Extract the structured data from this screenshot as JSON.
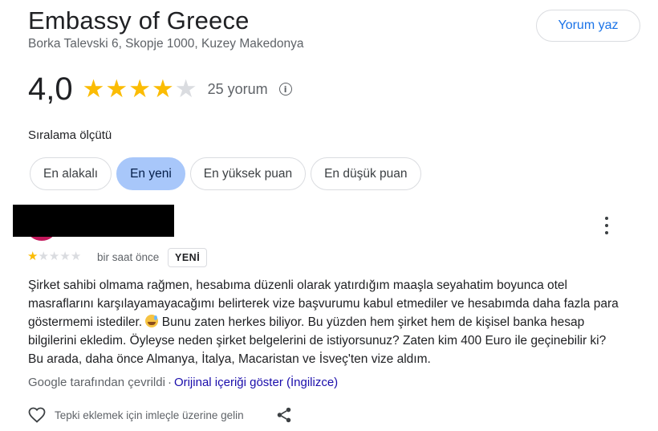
{
  "header": {
    "title": "Embassy of Greece",
    "address": "Borka Talevski 6, Skopje 1000, Kuzey Makedonya",
    "write_review_label": "Yorum yaz"
  },
  "summary": {
    "rating": "4,0",
    "stars_filled": 4,
    "stars_total": 5,
    "review_count": "25 yorum",
    "info_icon": "info-icon"
  },
  "sort": {
    "label": "Sıralama ölçütü",
    "options": [
      "En alakalı",
      "En yeni",
      "En yüksek puan",
      "En düşük puan"
    ],
    "selected": "En yeni"
  },
  "review": {
    "stars_filled": 1,
    "stars_total": 5,
    "time": "bir saat önce",
    "badge": "YENİ",
    "text_part1": "Şirket sahibi olmama rağmen, hesabıma düzenli olarak yatırdığım maaşla seyahatim boyunca otel masraflarını karşılayamayacağımı belirterek vize başvurumu kabul etmediler ve hesabımda daha fazla para göstermemi istediler.",
    "text_part2": "Bunu zaten herkes biliyor. Bu yüzden hem şirket hem de kişisel banka hesap bilgilerini ekledim. Öyleyse neden şirket belgelerini de istiyorsunuz? Zaten kim 400 Euro ile geçinebilir ki? Bu arada, daha önce Almanya, İtalya, Macaristan ve İsveç'ten vize aldım.",
    "translated_by": "Google tarafından çevrildi",
    "separator": "·",
    "show_original": "Orijinal içeriği göster (İngilizce)",
    "reaction_hint": "Tepki eklemek için imleçle üzerine gelin"
  },
  "colors": {
    "star_filled": "#fbbc04",
    "star_empty": "#dadce0",
    "accent": "#1a73e8",
    "chip_active": "#a8c7fa",
    "link": "#1a0dab"
  }
}
